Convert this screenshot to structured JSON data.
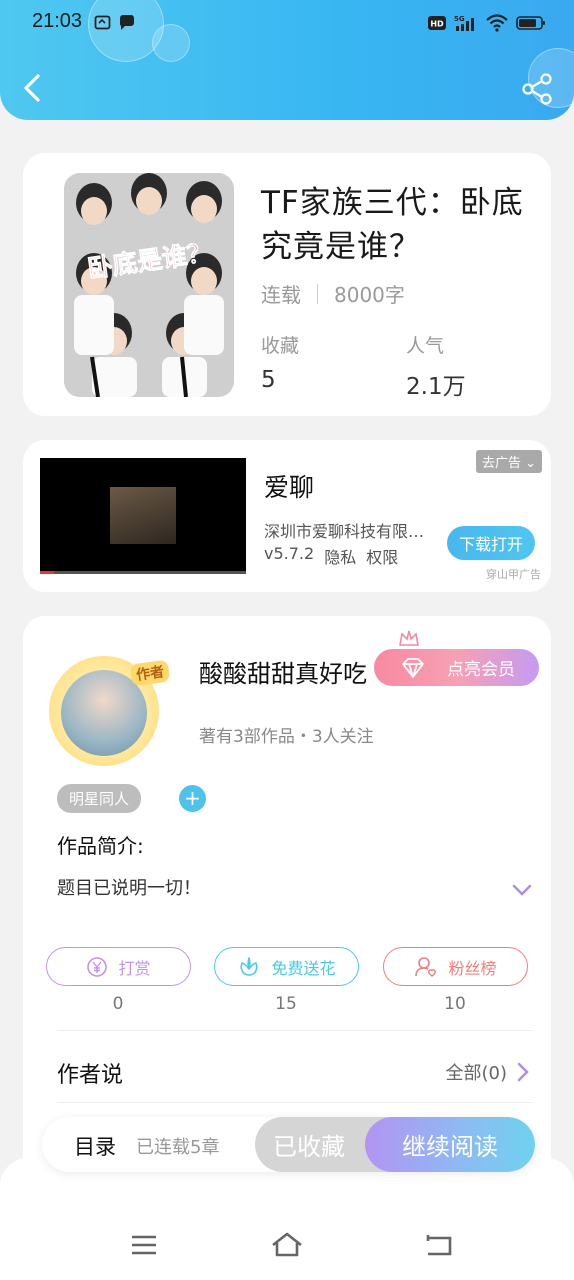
{
  "status_bar": {
    "time": "21:03",
    "left_icons": [
      "notification-icon",
      "chat-bubble-icon"
    ],
    "right_icons": [
      "hd-icon",
      "signal-5g-icon",
      "wifi-icon",
      "battery-icon"
    ],
    "network_label": "5G",
    "hd_label": "HD"
  },
  "header": {
    "back_icon": "chevron-left-icon",
    "share_icon": "share-icon",
    "accent_color": "#3fb9f2"
  },
  "book": {
    "title": "TF家族三代：卧底究竟是谁？",
    "status": "连载",
    "word_count": "8000字",
    "favorites_label": "收藏",
    "favorites_value": "5",
    "popularity_label": "人气",
    "popularity_value": "2.1万",
    "cover_text": "卧底是谁？"
  },
  "ad": {
    "badge": "去广告",
    "app_name": "爱聊",
    "company": "深圳市爱聊科技有限公司",
    "version": "v5.7.2",
    "privacy": "隐私",
    "permissions": "权限",
    "download_label": "下载打开",
    "source": "穿山甲广告"
  },
  "author": {
    "name": "酸酸甜甜真好吃",
    "role_tag": "作者",
    "vip_label": "点亮会员",
    "meta": "著有3部作品・3人关注",
    "tag": "明星同人",
    "add_tag": "+",
    "intro_label": "作品简介:",
    "intro_text": "题目已说明一切！"
  },
  "actions": [
    {
      "label": "打赏",
      "count": "0",
      "icon": "yen-coin-icon",
      "color": "#c592e8"
    },
    {
      "label": "免费送花",
      "count": "15",
      "icon": "flower-icon",
      "color": "#4dc9e6"
    },
    {
      "label": "粉丝榜",
      "count": "10",
      "icon": "fan-user-icon",
      "color": "#ef7f7f"
    }
  ],
  "author_says": {
    "title": "作者说",
    "all_label": "全部(0)"
  },
  "bottom_bar": {
    "toc_label": "目录",
    "toc_status": "已连载5章",
    "collected_label": "已收藏",
    "continue_label": "继续阅读"
  },
  "nav": {
    "menu_icon": "menu-icon",
    "home_icon": "home-icon",
    "back_icon": "back-icon"
  }
}
